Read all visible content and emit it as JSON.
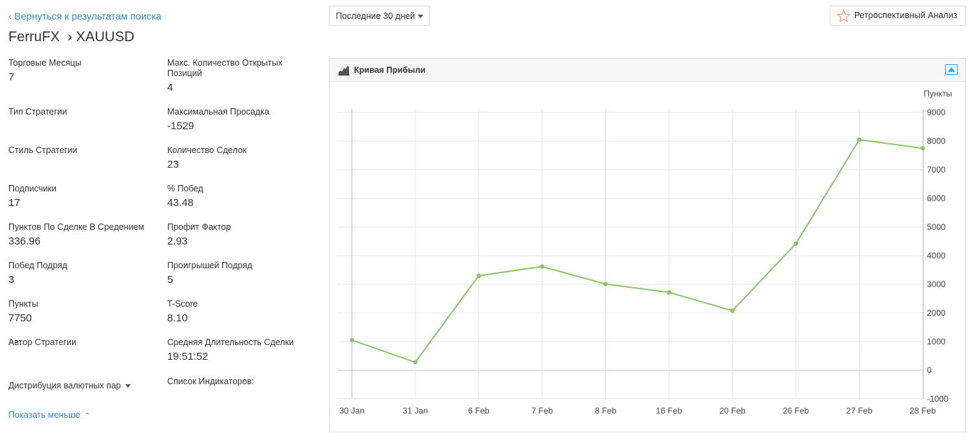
{
  "nav": {
    "back_label": "‹ Вернуться к результатам поиска"
  },
  "header": {
    "title": "FerruFX  › XAUUSD"
  },
  "period_select": {
    "value": "Последние 30 дней"
  },
  "retro_button": {
    "label": "Ретроспективный Анализ"
  },
  "stats": {
    "left": [
      {
        "label": "Торговые Месяцы",
        "value": "7"
      },
      {
        "label": "Тип Стратегии",
        "value": ""
      },
      {
        "label": "Стиль Стратегии",
        "value": ""
      },
      {
        "label": "Подписчики",
        "value": "17"
      },
      {
        "label": "Пунктов По Сделке В Средением",
        "value": "336.96"
      },
      {
        "label": "Побед Подряд",
        "value": "3"
      },
      {
        "label": "Пункты",
        "value": "7750"
      },
      {
        "label": "Автор Стратегии",
        "value": ""
      }
    ],
    "right": [
      {
        "label": "Макс. Количество Открытых Позиций",
        "value": "4"
      },
      {
        "label": "Максимальная Просадка",
        "value": "-1529"
      },
      {
        "label": "Количество Сделок",
        "value": "23"
      },
      {
        "label": "% Побед",
        "value": "43.48"
      },
      {
        "label": "Профит Фактор",
        "value": "2.93"
      },
      {
        "label": "Проигрышей Подряд",
        "value": "5"
      },
      {
        "label": "T-Score",
        "value": "8.10"
      },
      {
        "label": "Средняя Длительность Сделки",
        "value": "19:51:52"
      }
    ]
  },
  "distribution": {
    "label": "Дистрибуция валютных пар"
  },
  "indicators": {
    "label": "Список Индикаторов:"
  },
  "show_less": {
    "label": "Показать меньше"
  },
  "panel": {
    "title": "Кривая Прибыли"
  },
  "colors": {
    "link": "#2a8fd0",
    "line": "#8dc56a",
    "star": "#f0a07a"
  },
  "chart_data": {
    "type": "line",
    "title": "",
    "ylabel": "Пункты",
    "xlabel": "",
    "categories": [
      "30 Jan",
      "31 Jan",
      "6 Feb",
      "7 Feb",
      "8 Feb",
      "16 Feb",
      "20 Feb",
      "26 Feb",
      "27 Feb",
      "28 Feb"
    ],
    "series": [
      {
        "values": [
          1050,
          280,
          3300,
          3620,
          3010,
          2720,
          2080,
          4420,
          8050,
          7750
        ]
      }
    ],
    "ylim": [
      -1000,
      9000
    ],
    "yticks": [
      -1000,
      0,
      1000,
      2000,
      3000,
      4000,
      5000,
      6000,
      7000,
      8000,
      9000
    ],
    "grid": true
  }
}
